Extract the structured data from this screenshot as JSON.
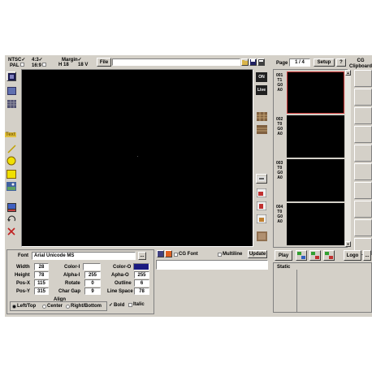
{
  "top": {
    "ntsc_label": "NTSC",
    "pal_label": "PAL",
    "ratio43_label": "4:3",
    "ratio169_label": "16:9",
    "margin_label": "Margin",
    "margin_h": "H 18",
    "margin_v": "18 V",
    "file_button": "File",
    "page_label": "Page",
    "page_value": "1 / 4",
    "setup_button": "Setup",
    "help_button": "?",
    "cg_clipboard": "CG Clipboard"
  },
  "left_tools": {
    "text_label": "Text"
  },
  "right_tools": {
    "on_label": "ON",
    "live_label": "Live"
  },
  "thumbnails": [
    {
      "num": "001",
      "l1": "T1",
      "l2": "G0",
      "l3": "A0"
    },
    {
      "num": "002",
      "l1": "T0",
      "l2": "G0",
      "l3": "A0"
    },
    {
      "num": "003",
      "l1": "T0",
      "l2": "G0",
      "l3": "A0"
    },
    {
      "num": "004",
      "l1": "T0",
      "l2": "G0",
      "l3": "A0"
    }
  ],
  "properties": {
    "font_label": "Font",
    "font_value": "Arial Unicode MS",
    "font_browse": "...",
    "width_label": "Width",
    "width_value": "28",
    "height_label": "Height",
    "height_value": "78",
    "posx_label": "Pos-X",
    "posx_value": "115",
    "posy_label": "Pos-Y",
    "posy_value": "315",
    "colori_label": "Color-I",
    "coloro_label": "Color-O",
    "alphai_label": "Alpha-I",
    "alphai_value": "255",
    "alphao_label": "Apha-O",
    "alphao_value": "255",
    "rotate_label": "Rotate",
    "rotate_value": "0",
    "outline_label": "Outline",
    "outline_value": "6",
    "chargap_label": "Char Gap",
    "chargap_value": "9",
    "linespace_label": "Line Space",
    "linespace_value": "78",
    "align_label": "Align",
    "align_left": "Left/Top",
    "align_center": "Center",
    "align_right": "Right/Bottom",
    "bold_label": "Bold",
    "italic_label": "Italic",
    "cg_font_label": "CG Font",
    "multiline_label": "Multiline",
    "update_button": "Update"
  },
  "bottom_right": {
    "play_button": "Play",
    "logo_button": "Logo",
    "more_button": "...",
    "static_label": "Static"
  },
  "colors": {
    "panel": "#d4d0c8",
    "canvas": "#000000",
    "color_i": "#ffffff",
    "color_o": "#1a1a80",
    "selected_thumb": "#d04040"
  }
}
